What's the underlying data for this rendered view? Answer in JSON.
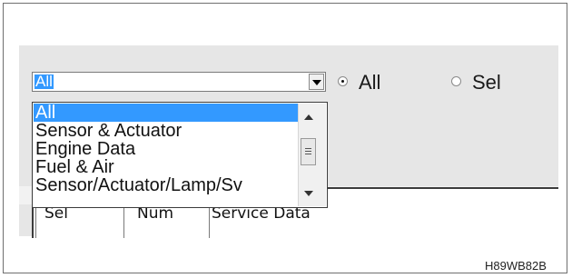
{
  "combo": {
    "selected_value": "All",
    "options": [
      "All",
      "Sensor & Actuator",
      "Engine Data",
      "Fuel & Air",
      "Sensor/Actuator/Lamp/Sv"
    ],
    "highlighted_index": 0,
    "dropdown_button_icon": "chevron-down-icon"
  },
  "filter_radios": [
    {
      "label": "All",
      "checked": true
    },
    {
      "label": "Sel",
      "checked": false
    }
  ],
  "grid": {
    "columns": [
      "Sel",
      "Num",
      "Service Data"
    ]
  },
  "figure_code": "H89WB82B",
  "colors": {
    "selection": "#3399ff",
    "panel": "#e6e6e6",
    "frame": "#6f6f6f"
  }
}
